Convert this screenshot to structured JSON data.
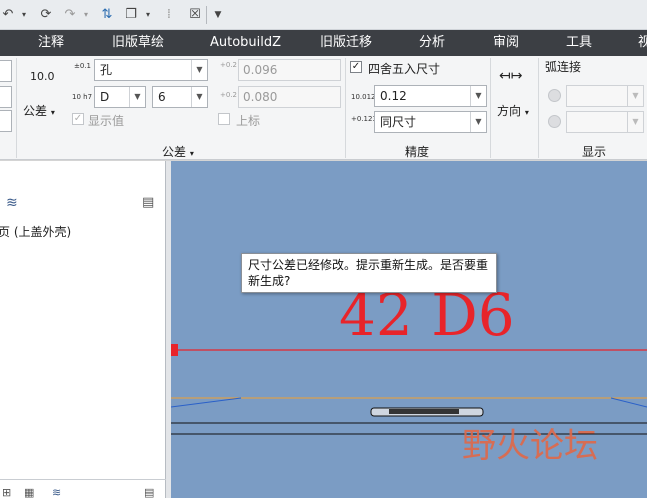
{
  "menubar": {
    "items": [
      "注释",
      "旧版草绘",
      "AutobuildZ",
      "旧版迁移",
      "分析",
      "审阅",
      "工具",
      "视"
    ]
  },
  "tolerance": {
    "display_value": "10.0",
    "button_label": "公差",
    "type_value": "孔",
    "type_icon": "±0.1",
    "fit_icon": "10 h7",
    "fit_letter": "D",
    "fit_number": "6",
    "show_value_label": "显示值",
    "upper_value": "0.096",
    "lower_value": "0.080",
    "upper_label": "上标",
    "upper_icon": "+0.2 -0.1",
    "lower_icon": "+0.2 -0.1",
    "group_label": "公差"
  },
  "precision": {
    "round_label": "四舍五入尺寸",
    "value_icon": "10.0123",
    "value": "0.12",
    "tol_icon": "+0.123 -0.123",
    "tol_value": "同尺寸",
    "group_label": "精度"
  },
  "display": {
    "direction_label": "方向",
    "arc_label": "弧连接",
    "group_label": "显示"
  },
  "model_tree": {
    "item_label": "页 (上盖外壳)"
  },
  "graphics": {
    "dimension_text": "42 D6",
    "tooltip_text": "尺寸公差已经修改。提示重新生成。是否要重新生成?",
    "watermark_text": "野火论坛"
  }
}
